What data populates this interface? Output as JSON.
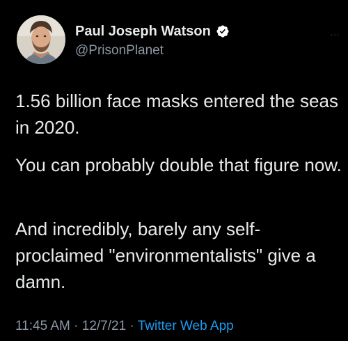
{
  "tweet": {
    "author": {
      "display_name": "Paul Joseph Watson",
      "handle": "@PrisonPlanet",
      "verified": true
    },
    "more_icon": "…",
    "paragraphs": [
      "1.56 billion face masks entered the seas in 2020.",
      "You can probably double that figure now.",
      "And incredibly, barely any self-proclaimed \"environmentalists\" give a damn."
    ],
    "time": "11:45 AM",
    "separator": "·",
    "date": "12/7/21",
    "source": "Twitter Web App"
  },
  "colors": {
    "background": "#000000",
    "primary_text": "#e7e9ea",
    "secondary_text": "#8b98a5",
    "link": "#1d9bf0",
    "verified_badge": "#ffffff"
  }
}
